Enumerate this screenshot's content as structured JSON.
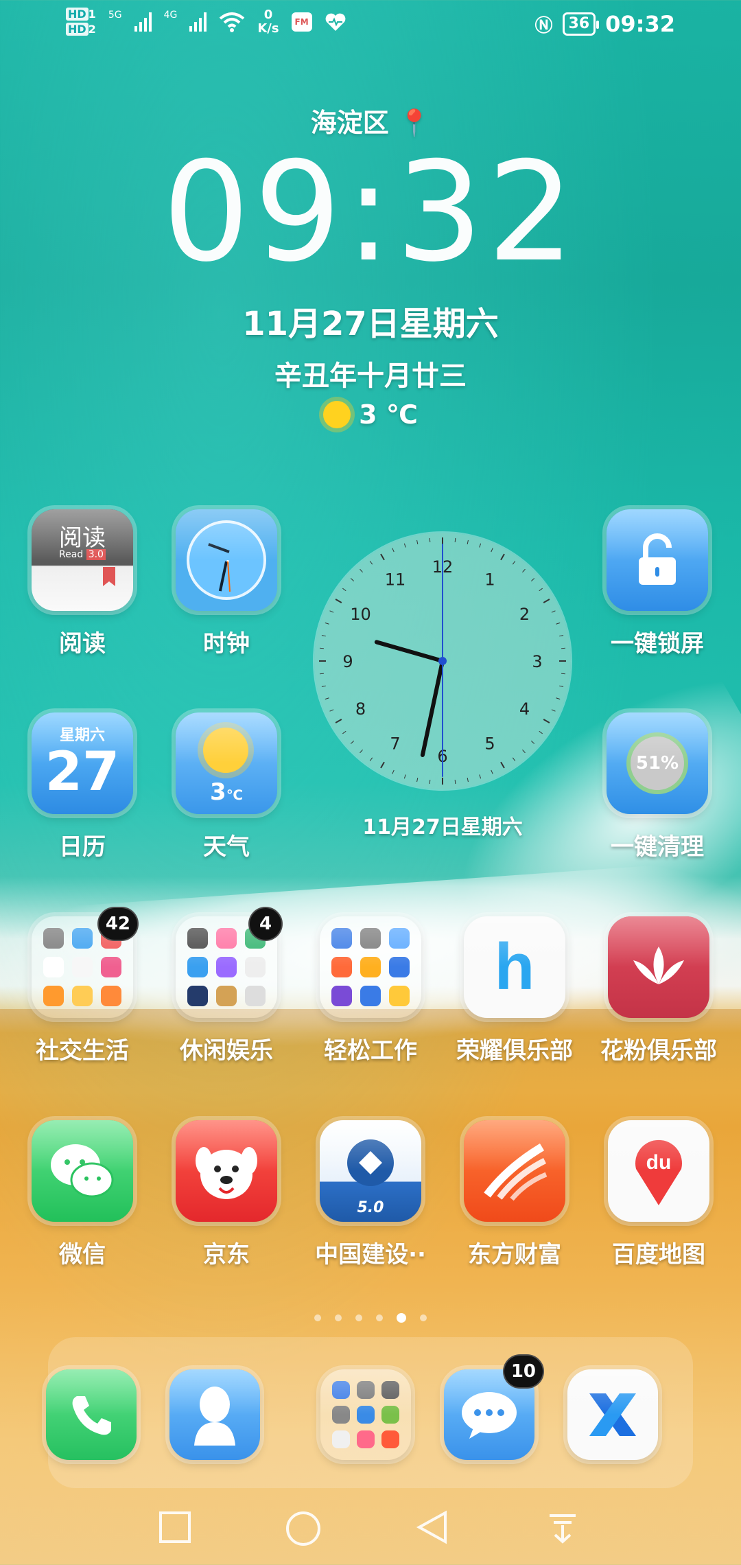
{
  "status_bar": {
    "hd1": "HD",
    "hd1_sub": "1",
    "hd2": "HD",
    "hd2_sub": "2",
    "net1": "5G",
    "net2": "4G",
    "speed_value": "0",
    "speed_unit": "K/s",
    "fm": "FM",
    "battery": "36",
    "time": "09:32"
  },
  "clock_widget": {
    "location": "海淀区",
    "time_hours": "09",
    "time_minutes": "32",
    "date": "11月27日星期六",
    "lunar_date": "辛丑年十月廿三",
    "temperature": "3 ℃"
  },
  "apps": {
    "row1": [
      {
        "label": "阅读",
        "icon": "read-icon"
      },
      {
        "label": "时钟",
        "icon": "clock-icon"
      },
      {
        "label": "一键锁屏",
        "icon": "lock-icon"
      }
    ],
    "row2": [
      {
        "label": "日历",
        "icon": "calendar-icon",
        "weekday": "星期六",
        "day": "27"
      },
      {
        "label": "天气",
        "icon": "weather-icon",
        "temp": "3",
        "unit": "℃"
      },
      {
        "label": "一键清理",
        "icon": "cleanup-icon",
        "percent": "51%"
      }
    ],
    "row3": [
      {
        "label": "社交生活",
        "icon": "folder-icon",
        "badge": "42"
      },
      {
        "label": "休闲娱乐",
        "icon": "folder-icon",
        "badge": "4"
      },
      {
        "label": "轻松工作",
        "icon": "folder-icon"
      },
      {
        "label": "荣耀俱乐部",
        "icon": "honor-club-icon"
      },
      {
        "label": "花粉俱乐部",
        "icon": "lotus-icon"
      }
    ],
    "row4": [
      {
        "label": "微信",
        "icon": "wechat-icon"
      },
      {
        "label": "京东",
        "icon": "jd-icon"
      },
      {
        "label": "中国建设··",
        "icon": "ccb-icon",
        "version": "5.0"
      },
      {
        "label": "东方财富",
        "icon": "eastmoney-icon"
      },
      {
        "label": "百度地图",
        "icon": "baidu-map-icon",
        "mark": "du"
      }
    ]
  },
  "analog_clock": {
    "numbers": [
      "12",
      "1",
      "2",
      "3",
      "4",
      "5",
      "6",
      "7",
      "8",
      "9",
      "10",
      "11"
    ],
    "date": "11月27日星期六",
    "hour": 9,
    "minute": 32
  },
  "dock": {
    "items": [
      {
        "icon": "phone-icon"
      },
      {
        "icon": "contacts-icon"
      },
      {
        "icon": "folder-icon"
      },
      {
        "icon": "messages-icon",
        "badge": "10"
      },
      {
        "icon": "browser-x-icon"
      }
    ]
  },
  "page_indicator": {
    "count": 6,
    "active": 4
  },
  "colors": {
    "sea": "#1ab3a3",
    "sand": "#e9a63a",
    "badge": "#111111"
  }
}
